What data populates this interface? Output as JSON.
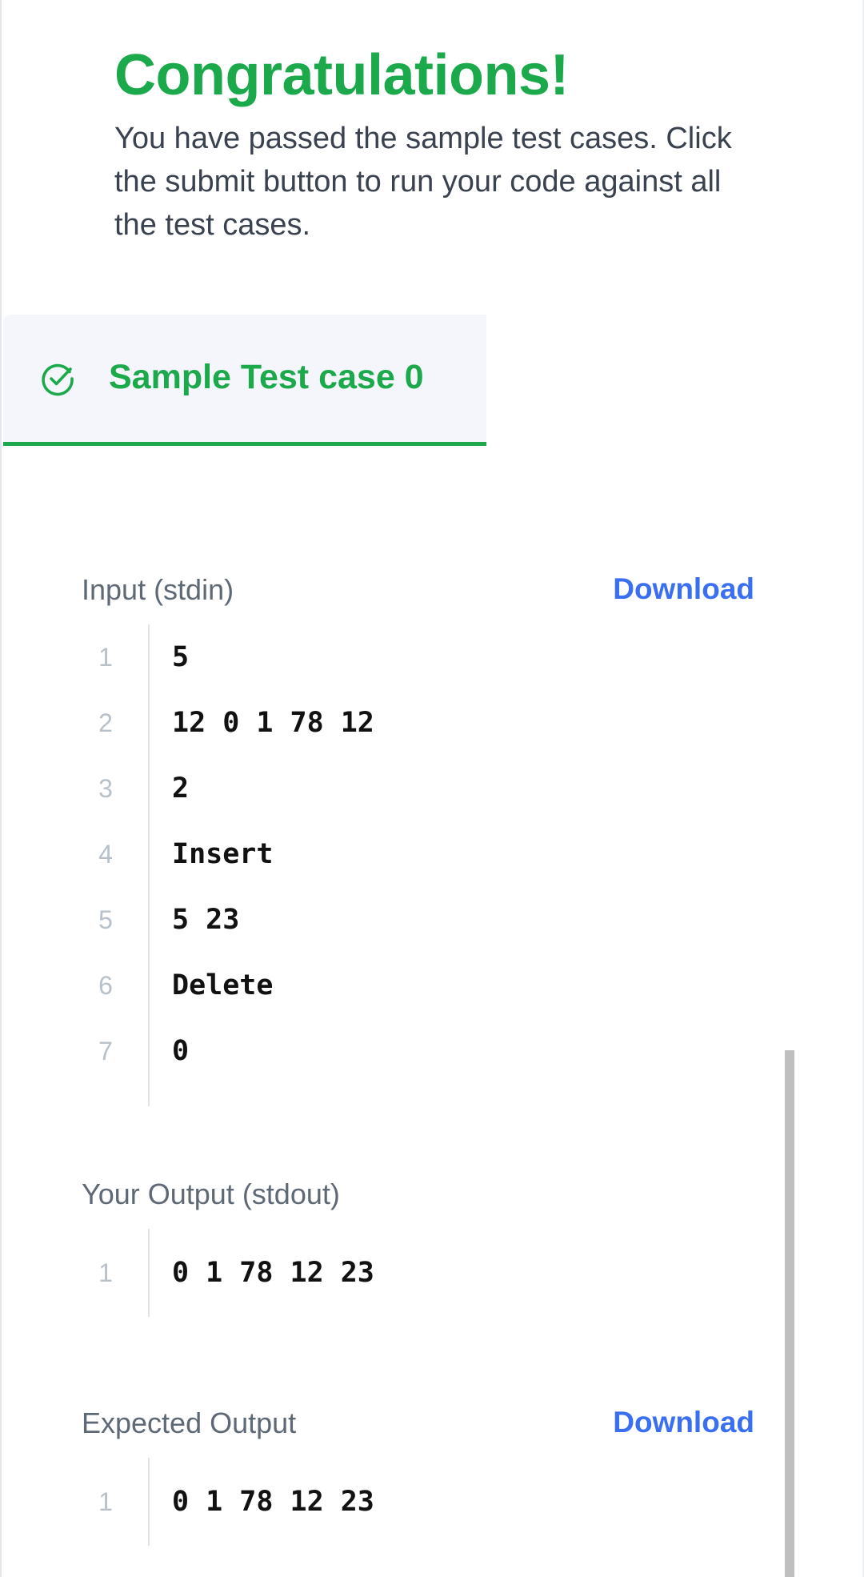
{
  "header": {
    "title": "Congratulations!",
    "message": "You have passed the sample test cases. Click the submit button to run your code against all the test cases."
  },
  "tab": {
    "label": "Sample Test case 0",
    "status_icon": "check-circle-icon"
  },
  "input_section": {
    "title": "Input (stdin)",
    "download_label": "Download",
    "lines": [
      {
        "n": "1",
        "text": "5"
      },
      {
        "n": "2",
        "text": "12 0 1 78 12"
      },
      {
        "n": "3",
        "text": "2"
      },
      {
        "n": "4",
        "text": "Insert"
      },
      {
        "n": "5",
        "text": "5 23"
      },
      {
        "n": "6",
        "text": "Delete"
      },
      {
        "n": "7",
        "text": "0"
      }
    ]
  },
  "output_section": {
    "title": "Your Output (stdout)",
    "lines": [
      {
        "n": "1",
        "text": "0 1 78 12 23"
      }
    ]
  },
  "expected_section": {
    "title": "Expected Output",
    "download_label": "Download",
    "lines": [
      {
        "n": "1",
        "text": "0 1 78 12 23"
      }
    ]
  },
  "colors": {
    "success": "#1ba94c",
    "link": "#3b6ff2",
    "text": "#39424e",
    "muted": "#5e6975"
  }
}
